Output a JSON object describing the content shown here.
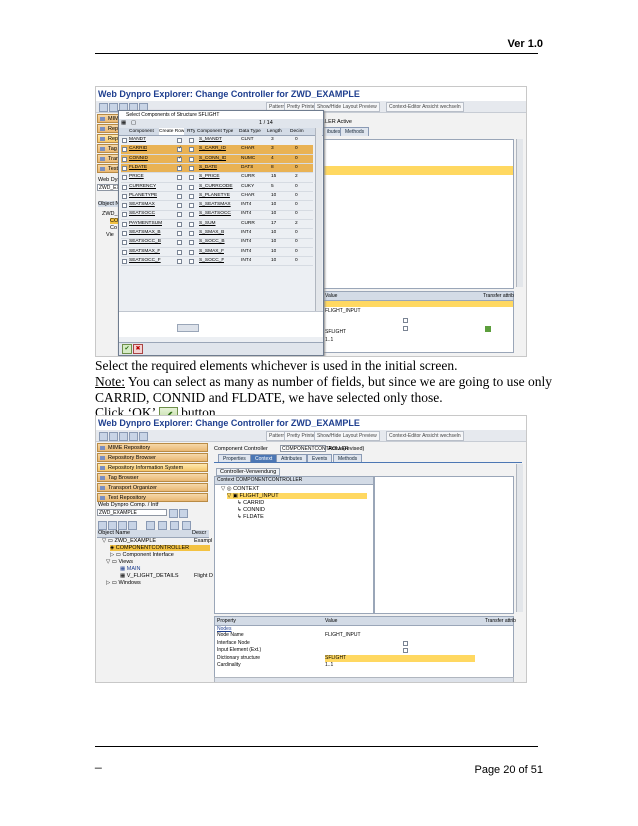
{
  "header": {
    "version": "Ver 1.0"
  },
  "footer": {
    "dash": "_",
    "page": "Page 20 of 51"
  },
  "shot1": {
    "title": "Web Dynpro Explorer: Change Controller for ZWD_EXAMPLE",
    "toolbar": [
      "Pattern",
      "Pretty Printer",
      "Show/Hide Layout Preview",
      "Context-Editor Ansicht wechseln"
    ],
    "left_buttons": [
      "MIME Repository",
      "Repository Browser",
      "Repository Information System",
      "Tag Browser",
      "Transport Organizer",
      "Test Repository"
    ],
    "left_small": [
      "Web Dynpro",
      "ZWD_EXAM"
    ],
    "object_name": "Object Name",
    "tree": [
      "ZWD_",
      "CO",
      "Co",
      "Vie"
    ],
    "right_status": "LLER  Active",
    "right_tabs": [
      "ibutes",
      "Methods"
    ],
    "prop_headers": {
      "value": "Value",
      "transfer": "Transfer attrib"
    },
    "prop_values": [
      "FLIGHT_INPUT",
      "",
      "",
      "SFLIGHT",
      "1..1"
    ],
    "popup": {
      "title": "Select Components of Structure SFLIGHT",
      "pager": "1 / 14",
      "columns": [
        "Component",
        "Create Row",
        "RTy",
        "Component Type",
        "Data Type",
        "Length",
        "Decim"
      ],
      "rows": [
        {
          "comp": "MANDT",
          "sel": false,
          "type": "S_MANDT",
          "dtype": "CLNT",
          "len": "3",
          "dec": "0"
        },
        {
          "comp": "CARRID",
          "sel": true,
          "type": "S_CARR_ID",
          "dtype": "CHAR",
          "len": "3",
          "dec": "0"
        },
        {
          "comp": "CONNID",
          "sel": true,
          "type": "S_CONN_ID",
          "dtype": "NUMC",
          "len": "4",
          "dec": "0"
        },
        {
          "comp": "FLDATE",
          "sel": true,
          "type": "S_DATE",
          "dtype": "DATS",
          "len": "8",
          "dec": "0"
        },
        {
          "comp": "PRICE",
          "sel": false,
          "type": "S_PRICE",
          "dtype": "CURR",
          "len": "15",
          "dec": "2"
        },
        {
          "comp": "CURRENCY",
          "sel": false,
          "type": "S_CURRCODE",
          "dtype": "CUKY",
          "len": "5",
          "dec": "0"
        },
        {
          "comp": "PLANETYPE",
          "sel": false,
          "type": "S_PLANETYE",
          "dtype": "CHAR",
          "len": "10",
          "dec": "0"
        },
        {
          "comp": "SEATSMAX",
          "sel": false,
          "type": "S_SEATSMAX",
          "dtype": "INT4",
          "len": "10",
          "dec": "0"
        },
        {
          "comp": "SEATSOCC",
          "sel": false,
          "type": "S_SEATSOCC",
          "dtype": "INT4",
          "len": "10",
          "dec": "0"
        },
        {
          "comp": "PAYMENTSUM",
          "sel": false,
          "type": "S_SUM",
          "dtype": "CURR",
          "len": "17",
          "dec": "2"
        },
        {
          "comp": "SEATSMAX_B",
          "sel": false,
          "type": "S_SMAX_B",
          "dtype": "INT4",
          "len": "10",
          "dec": "0"
        },
        {
          "comp": "SEATSOCC_B",
          "sel": false,
          "type": "S_SOCC_B",
          "dtype": "INT4",
          "len": "10",
          "dec": "0"
        },
        {
          "comp": "SEATSMAX_F",
          "sel": false,
          "type": "S_SMAX_F",
          "dtype": "INT4",
          "len": "10",
          "dec": "0"
        },
        {
          "comp": "SEATSOCC_F",
          "sel": false,
          "type": "S_SOCC_F",
          "dtype": "INT4",
          "len": "10",
          "dec": "0"
        }
      ]
    }
  },
  "instructions": {
    "line1": "Select the required elements whichever is used in the initial screen.",
    "note_label": "Note:",
    "note_text": " You can select as many as number of fields, but since we are going to use only",
    "line3": "CARRID, CONNID and FLDATE, we have selected only those.",
    "click_pre": "Click ‘OK’",
    "click_post": "button."
  },
  "shot2": {
    "title": "Web Dynpro Explorer: Change Controller for ZWD_EXAMPLE",
    "toolbar": [
      "Pattern",
      "Pretty Printer",
      "Show/Hide Layout Preview",
      "Context-Editor Ansicht wechseln"
    ],
    "left_buttons": [
      "MIME Repository",
      "Repository Browser",
      "Repository Information System",
      "Tag Browser",
      "Transport Organizer",
      "Test Repository"
    ],
    "comp_label": "Web Dynpro Comp. / Intf",
    "comp_value": "ZWD_EXAMPLE",
    "obj_headers": [
      "Object Name",
      "Descr"
    ],
    "tree": [
      {
        "label": "ZWD_EXAMPLE",
        "extra": "Exampl"
      },
      {
        "label": "COMPONENTCONTROLLER",
        "extra": ""
      },
      {
        "label": "Component Interface",
        "extra": ""
      },
      {
        "label": "Views",
        "extra": ""
      },
      {
        "label": "MAIN",
        "extra": ""
      },
      {
        "label": "V_FLIGHT_DETAILS",
        "extra": "Flight D"
      },
      {
        "label": "Windows",
        "extra": ""
      }
    ],
    "controller_label": "Component Controller",
    "controller_value": "COMPONENTCONTROLLER",
    "status": "Active(revised)",
    "tabs": [
      "Properties",
      "Context",
      "Attributes",
      "Events",
      "Methods"
    ],
    "sub_tab": "Controller-Verwendung",
    "context_title": "Context COMPONENTCONTROLLER",
    "context_tree": [
      "CONTEXT",
      "FLIGHT_INPUT",
      "CARRID",
      "CONNID",
      "FLDATE"
    ],
    "prop_headers": [
      "Property",
      "Value",
      "Transfer attrib"
    ],
    "prop_group": "Nodes",
    "props": [
      {
        "name": "Node Name",
        "value": "FLIGHT_INPUT"
      },
      {
        "name": "Interface Node",
        "value": ""
      },
      {
        "name": "Input Element (Ext.)",
        "value": ""
      },
      {
        "name": "Dictionary structure",
        "value": "SFLIGHT"
      },
      {
        "name": "Cardinality",
        "value": "1..1"
      }
    ]
  }
}
